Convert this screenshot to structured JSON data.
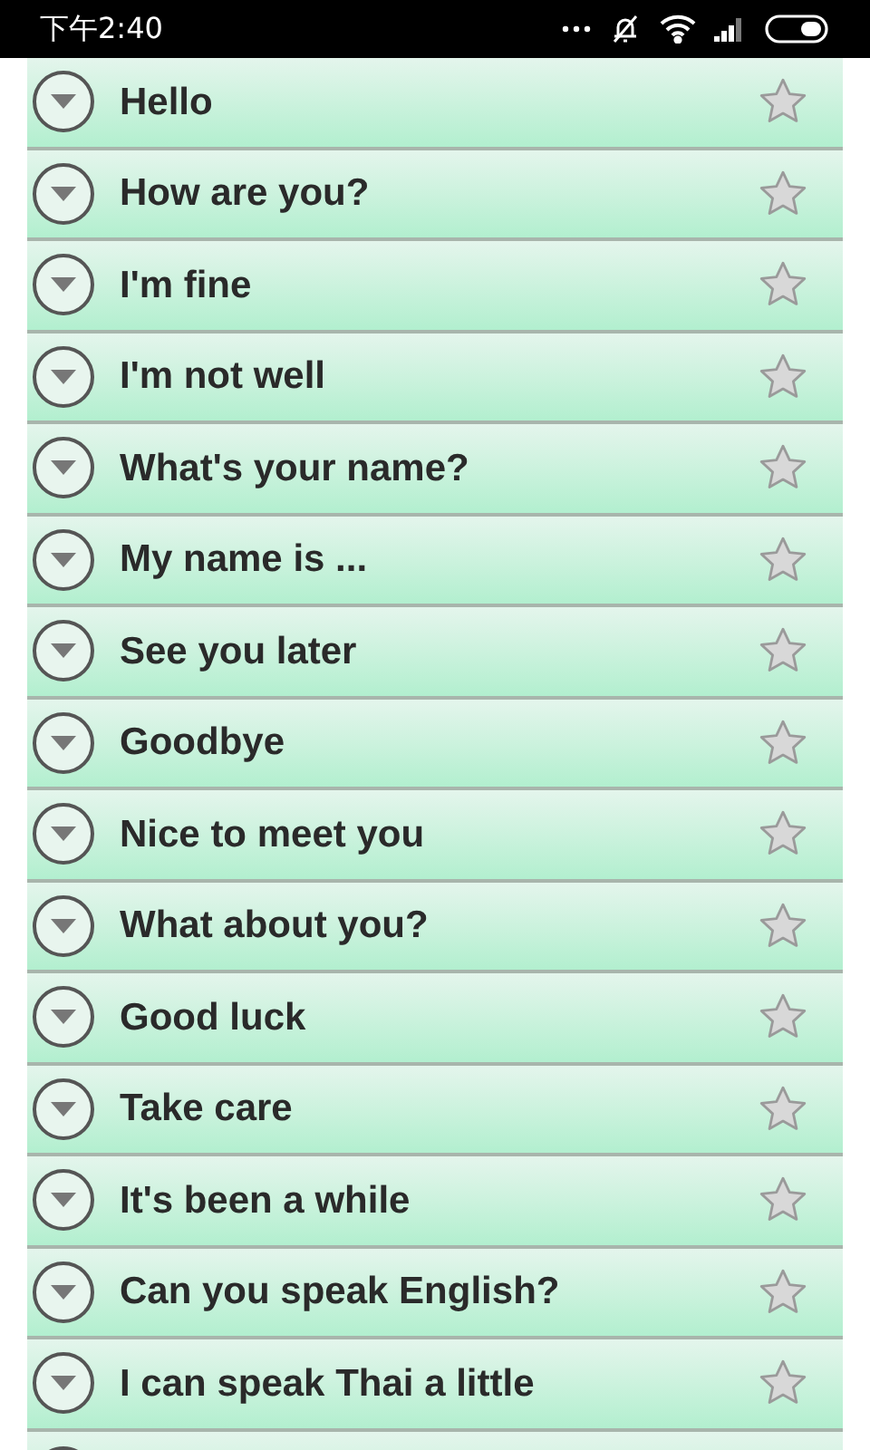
{
  "status_bar": {
    "time": "下午2:40"
  },
  "phrases": [
    {
      "label": "Hello",
      "starred": false
    },
    {
      "label": "How are you?",
      "starred": false
    },
    {
      "label": "I'm fine",
      "starred": false
    },
    {
      "label": "I'm not well",
      "starred": false
    },
    {
      "label": "What's your name?",
      "starred": false
    },
    {
      "label": "My name is ...",
      "starred": false
    },
    {
      "label": "See you later",
      "starred": false
    },
    {
      "label": "Goodbye",
      "starred": false
    },
    {
      "label": "Nice to meet you",
      "starred": false
    },
    {
      "label": "What about you?",
      "starred": false
    },
    {
      "label": "Good luck",
      "starred": false
    },
    {
      "label": "Take care",
      "starred": false
    },
    {
      "label": "It's been a while",
      "starred": false
    },
    {
      "label": "Can you speak English?",
      "starred": false
    },
    {
      "label": "I can speak Thai a little",
      "starred": false
    }
  ]
}
